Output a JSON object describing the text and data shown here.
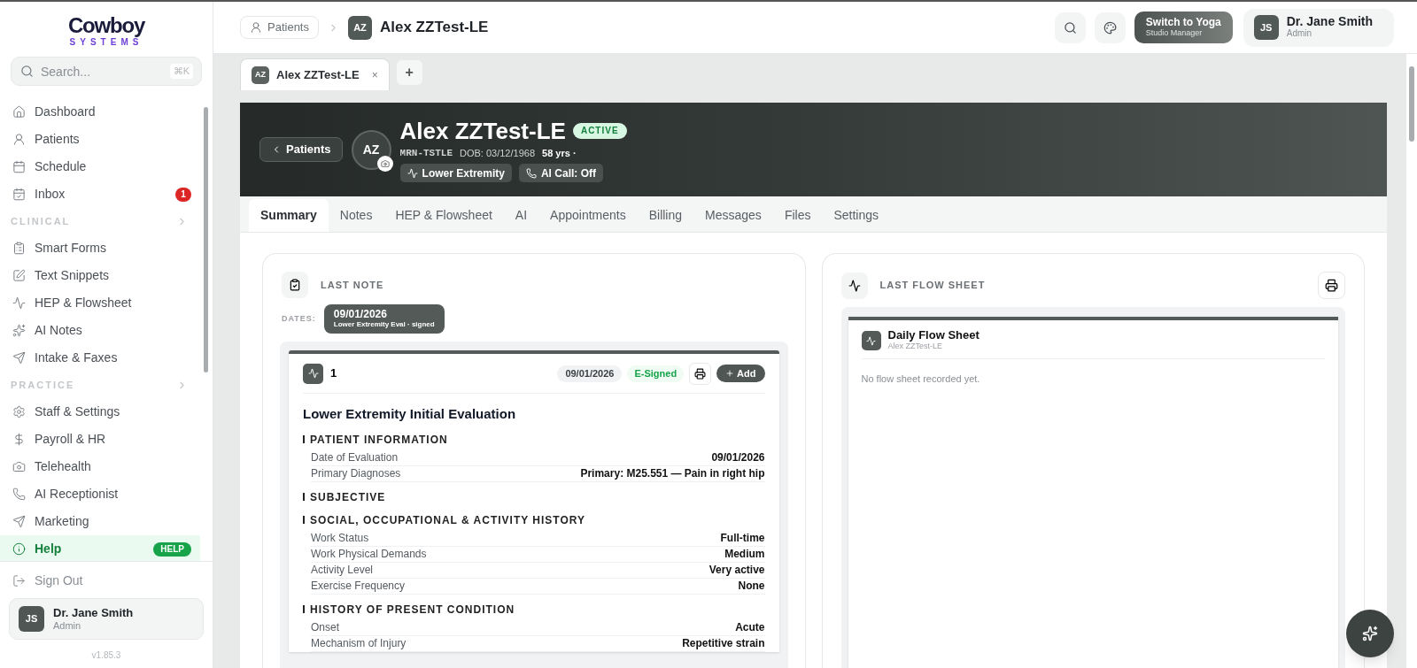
{
  "sidebar": {
    "logo": {
      "name": "Cowboy",
      "tagline": "SYSTEMS"
    },
    "search": {
      "placeholder": "Search...",
      "shortcut": "⌘K"
    },
    "nav": [
      {
        "kind": "item",
        "label": "Dashboard",
        "selected": false
      },
      {
        "kind": "item",
        "label": "Patients",
        "selected": false
      },
      {
        "kind": "item",
        "label": "Schedule",
        "selected": false
      },
      {
        "kind": "item",
        "label": "Inbox",
        "selected": false,
        "badge": "1"
      },
      {
        "kind": "section",
        "label": "CLINICAL"
      },
      {
        "kind": "item",
        "label": "Smart Forms",
        "selected": false
      },
      {
        "kind": "item",
        "label": "Text Snippets",
        "selected": false
      },
      {
        "kind": "item",
        "label": "HEP & Flowsheet",
        "selected": false
      },
      {
        "kind": "item",
        "label": "AI Notes",
        "selected": false
      },
      {
        "kind": "item",
        "label": "Intake & Faxes",
        "selected": false
      },
      {
        "kind": "section",
        "label": "PRACTICE"
      },
      {
        "kind": "item",
        "label": "Staff & Settings",
        "selected": false
      },
      {
        "kind": "item",
        "label": "Payroll & HR",
        "selected": false
      },
      {
        "kind": "item",
        "label": "Telehealth",
        "selected": false
      },
      {
        "kind": "item",
        "label": "AI Receptionist",
        "selected": false
      },
      {
        "kind": "item",
        "label": "Marketing",
        "selected": false
      },
      {
        "kind": "item",
        "label": "Help",
        "selected": true,
        "badge": "HELP"
      }
    ],
    "sign_out": "Sign Out",
    "user": {
      "initials": "JS",
      "name": "Dr. Jane Smith",
      "role": "Admin"
    },
    "version": "v1.85.3"
  },
  "header": {
    "breadcrumb": "Patients",
    "patient_initials": "AZ",
    "patient_name": "Alex ZZTest-LE",
    "switch": {
      "title": "Switch to Yoga",
      "subtitle": "Studio Manager"
    },
    "user": {
      "initials": "JS",
      "name": "Dr. Jane Smith",
      "role": "Admin"
    }
  },
  "open_tabs": [
    {
      "initials": "AZ",
      "label": "Alex ZZTest-LE",
      "close": "×",
      "selected": true
    }
  ],
  "add_tab": "+",
  "banner": {
    "back": "Patients",
    "initials": "AZ",
    "name": "Alex ZZTest-LE",
    "status": "ACTIVE",
    "mrn": "MRN-TSTLE",
    "dob": "DOB: 03/12/1968",
    "age": "58 yrs ·",
    "chips": [
      "Lower Extremity",
      "AI Call: Off"
    ]
  },
  "tabs": [
    {
      "label": "Summary",
      "selected": true
    },
    {
      "label": "Notes",
      "selected": false
    },
    {
      "label": "HEP & Flowsheet",
      "selected": false
    },
    {
      "label": "AI",
      "selected": false
    },
    {
      "label": "Appointments",
      "selected": false
    },
    {
      "label": "Billing",
      "selected": false
    },
    {
      "label": "Messages",
      "selected": false
    },
    {
      "label": "Files",
      "selected": false
    },
    {
      "label": "Settings",
      "selected": false
    }
  ],
  "last_note": {
    "title": "LAST NOTE",
    "dates_label": "DATES:",
    "dates": [
      {
        "date": "09/01/2026",
        "caption": "Lower Extremity Eval · signed",
        "selected": true
      }
    ],
    "note": {
      "number": "1",
      "date": "09/01/2026",
      "status": "E-Signed",
      "add": "Add",
      "title": "Lower Extremity Initial Evaluation",
      "sections": [
        {
          "heading": "PATIENT INFORMATION",
          "rows": [
            {
              "label": "Date of Evaluation",
              "value": "09/01/2026"
            },
            {
              "label": "Primary Diagnoses",
              "value": "Primary: M25.551 — Pain in right hip"
            }
          ]
        },
        {
          "heading": "SUBJECTIVE"
        },
        {
          "heading": "SOCIAL, OCCUPATIONAL & ACTIVITY HISTORY",
          "rows": [
            {
              "label": "Work Status",
              "value": "Full-time"
            },
            {
              "label": "Work Physical Demands",
              "value": "Medium"
            },
            {
              "label": "Activity Level",
              "value": "Very active"
            },
            {
              "label": "Exercise Frequency",
              "value": "None"
            }
          ]
        },
        {
          "heading": "HISTORY OF PRESENT CONDITION",
          "rows": [
            {
              "label": "Onset",
              "value": "Acute"
            },
            {
              "label": "Mechanism of Injury",
              "value": "Repetitive strain"
            }
          ]
        }
      ]
    }
  },
  "last_flow_sheet": {
    "title": "LAST FLOW SHEET",
    "sheet_title": "Daily Flow Sheet",
    "sheet_subtitle": "Alex ZZTest-LE",
    "empty": "No flow sheet recorded yet."
  }
}
